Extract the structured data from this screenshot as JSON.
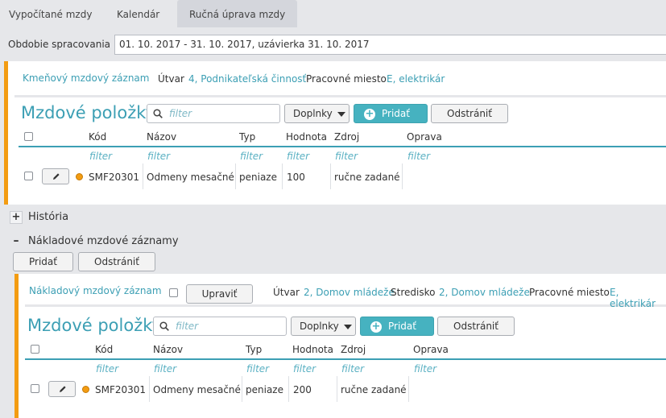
{
  "tabs": [
    {
      "label": "Vypočítané mzdy"
    },
    {
      "label": "Kalendár"
    },
    {
      "label": "Ručná úprava mzdy"
    }
  ],
  "period": {
    "label": "Obdobie spracovania",
    "value": "01. 10. 2017 - 31. 10. 2017, uzávierka 31. 10. 2017"
  },
  "top_panel": {
    "record_link": "Kmeňový mzdový záznam",
    "utvar_label": "Útvar",
    "utvar_value": "4, Podnikateľská činnosť",
    "miesto_label": "Pracovné miesto",
    "miesto_value": "E, elektrikár",
    "items": {
      "title": "Mzdové položky",
      "search_placeholder": "filter",
      "doplnky_label": "Doplnky",
      "add_label": "Pridať",
      "remove_label": "Odstrániť",
      "columns": [
        "Kód",
        "Názov",
        "Typ",
        "Hodnota",
        "Zdroj",
        "Oprava"
      ],
      "filter_text": "filter",
      "rows": [
        {
          "kod": "SMF20301",
          "nazov": "Odmeny mesačné",
          "typ": "peniaze",
          "hodnota": "100",
          "zdroj": "ručne zadané",
          "oprava": ""
        }
      ]
    }
  },
  "history": {
    "toggle": "+",
    "label": "História"
  },
  "cost_section": {
    "toggle": "–",
    "label": "Nákladové mzdové záznamy",
    "add_label": "Pridať",
    "remove_label": "Odstrániť",
    "panel": {
      "record_link": "Nákladový mzdový záznam",
      "edit_label": "Upraviť",
      "utvar_label": "Útvar",
      "utvar_value": "2, Domov mládeže",
      "stredisko_label": "Stredisko",
      "stredisko_value": "2, Domov mládeže",
      "miesto_label": "Pracovné miesto",
      "miesto_value": "E, elektrikár",
      "items": {
        "title": "Mzdové položky",
        "search_placeholder": "filter",
        "doplnky_label": "Doplnky",
        "add_label": "Pridať",
        "remove_label": "Odstrániť",
        "columns": [
          "Kód",
          "Názov",
          "Typ",
          "Hodnota",
          "Zdroj",
          "Oprava"
        ],
        "filter_text": "filter",
        "rows": [
          {
            "kod": "SMF20301",
            "nazov": "Odmeny mesačné",
            "typ": "peniaze",
            "hodnota": "200",
            "zdroj": "ručne zadané",
            "oprava": ""
          }
        ]
      }
    }
  },
  "colors": {
    "accent": "#3c9fb4",
    "orange": "#f39c12",
    "teal_button": "#46b2c0"
  },
  "icons": [
    "search-icon",
    "caret-down-icon",
    "plus-circle-icon",
    "pencil-icon",
    "status-dot-icon",
    "checkbox-icon"
  ]
}
